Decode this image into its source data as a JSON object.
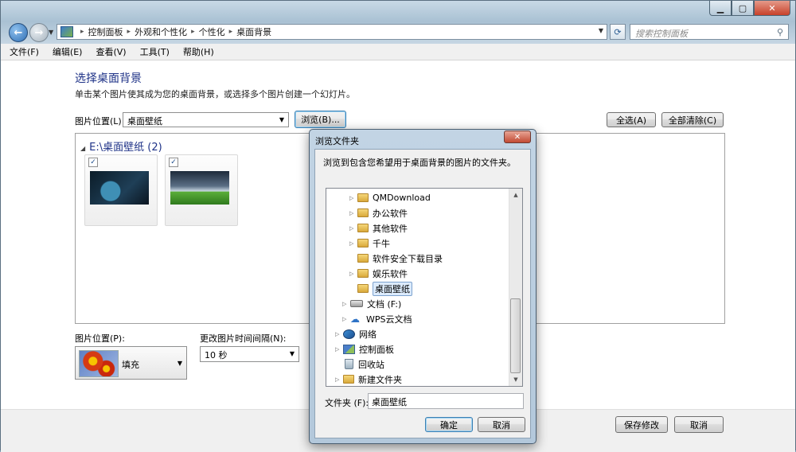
{
  "window": {
    "controls": {
      "minimize": "▁",
      "maximize": "▢",
      "close": "✕"
    }
  },
  "nav": {
    "breadcrumbs": [
      "控制面板",
      "外观和个性化",
      "个性化",
      "桌面背景"
    ],
    "search_placeholder": "搜索控制面板"
  },
  "menu": [
    "文件(F)",
    "编辑(E)",
    "查看(V)",
    "工具(T)",
    "帮助(H)"
  ],
  "main": {
    "title": "选择桌面背景",
    "description": "单击某个图片使其成为您的桌面背景，或选择多个图片创建一个幻灯片。",
    "location_label": "图片位置(L):",
    "location_value": "桌面壁纸",
    "browse_button": "浏览(B)...",
    "select_all_button": "全选(A)",
    "clear_all_button": "全部清除(C)",
    "group_header": "E:\\桌面壁纸 (2)",
    "position_label": "图片位置(P):",
    "position_value": "填充",
    "interval_label": "更改图片时间间隔(N):",
    "interval_value": "10 秒"
  },
  "dialog": {
    "title": "浏览文件夹",
    "description": "浏览到包含您希望用于桌面背景的图片的文件夹。",
    "tree": [
      {
        "label": "QMDownload",
        "icon": "folder",
        "indent": 1,
        "expander": true
      },
      {
        "label": "办公软件",
        "icon": "folder",
        "indent": 1,
        "expander": true
      },
      {
        "label": "其他软件",
        "icon": "folder",
        "indent": 1,
        "expander": true
      },
      {
        "label": "千牛",
        "icon": "folder",
        "indent": 1,
        "expander": true
      },
      {
        "label": "软件安全下载目录",
        "icon": "folder",
        "indent": 1,
        "expander": false
      },
      {
        "label": "娱乐软件",
        "icon": "folder",
        "indent": 1,
        "expander": true
      },
      {
        "label": "桌面壁纸",
        "icon": "folder",
        "indent": 1,
        "expander": false,
        "selected": true
      },
      {
        "label": "文档 (F:)",
        "icon": "drive",
        "indent": 0,
        "expander": true
      },
      {
        "label": "WPS云文档",
        "icon": "cloud",
        "indent": 0,
        "expander": true
      },
      {
        "label": "网络",
        "icon": "network",
        "indent": -1,
        "expander": true
      },
      {
        "label": "控制面板",
        "icon": "cpanel",
        "indent": -1,
        "expander": true
      },
      {
        "label": "回收站",
        "icon": "bin",
        "indent": -1,
        "expander": false
      },
      {
        "label": "新建文件夹",
        "icon": "folder",
        "indent": -1,
        "expander": true
      }
    ],
    "folder_label": "文件夹 (F):",
    "folder_value": "桌面壁纸",
    "ok_button": "确定",
    "cancel_button": "取消"
  },
  "background_buttons": {
    "save": "保存修改",
    "cancel": "取消"
  }
}
